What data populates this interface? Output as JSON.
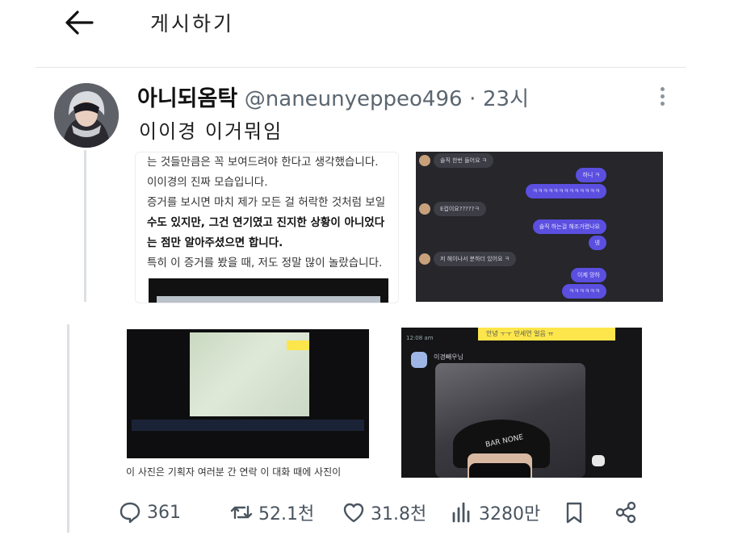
{
  "header": {
    "title": "게시하기"
  },
  "tweet": {
    "author_name": "아니되옴탁",
    "handle": "@naneunyeppeo496",
    "separator": "·",
    "time": "23시",
    "text": "이이경 이거뭐임"
  },
  "media1": {
    "lines": [
      "는 것들만큼은 꼭 보여드려야 한다고 생각했습니다.",
      "이이경의 진짜 모습입니다.",
      "증거를 보시면 마치 제가 모든 걸 허락한 것처럼 보일",
      "수도 있지만, 그건 연기였고 진지한 상황이 아니었다",
      "는 점만 알아주셨으면 합니다.",
      "특히 이 증거를 봤을 때, 저도 정말 많이 놀랐습니다."
    ]
  },
  "media2": {
    "messages": [
      {
        "side": "left",
        "text": "솔직 한번 들어요 ㅋ"
      },
      {
        "side": "right",
        "text": "하니 ㅋ"
      },
      {
        "side": "right",
        "text": "ㅋㅋㅋㅋㅋㅋㅋㅋㅋㅋㅋㅋㅋ"
      },
      {
        "side": "left",
        "text": "E컵이요?????ㅋ"
      },
      {
        "side": "right",
        "text": "솔직 하는걸 해조거렸나요"
      },
      {
        "side": "right",
        "text": "넹"
      },
      {
        "side": "left",
        "text": "저 헤이나서 분하더 있어요 ㅋ"
      },
      {
        "side": "right",
        "text": "이제 망하"
      },
      {
        "side": "right",
        "text": "ㅋㅋㅋㅋㅋㅋ"
      }
    ]
  },
  "media3": {
    "caption": "이 사진은 기획자 여러분 간 연락 이 대화 때에 사진이"
  },
  "media4": {
    "time": "12:08 am",
    "banner": "안녕 ㅜㅜ 만세연 얼음 ㅠ",
    "sender": "이경빼우님",
    "cap_text": "BAR NONE"
  },
  "stats": {
    "replies": "361",
    "retweets": "52.1천",
    "likes": "31.8천",
    "views": "3280만"
  }
}
